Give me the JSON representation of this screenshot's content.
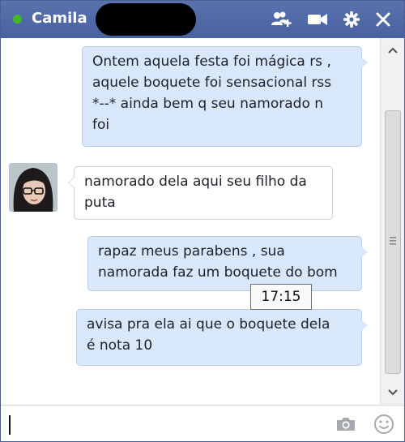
{
  "header": {
    "contact_name": "Camila",
    "status": "online",
    "icons": [
      "add-friends-icon",
      "video-camera-icon",
      "gear-icon",
      "close-icon"
    ]
  },
  "messages": [
    {
      "direction": "out",
      "lines": [
        "Ontem aquela festa foi mágica rs ,",
        "aquele boquete foi sensacional rss",
        "*--* ainda bem q seu namorado n",
        "foi"
      ]
    },
    {
      "direction": "in",
      "lines": [
        "namorado dela aqui seu filho da",
        "puta"
      ]
    },
    {
      "direction": "out",
      "lines": [
        "rapaz meus parabens , sua",
        "namorada faz um boquete do bom"
      ]
    },
    {
      "direction": "out",
      "lines": [
        "avisa pra ela ai que o boquete dela",
        "é nota 10"
      ]
    }
  ],
  "tooltip": {
    "time": "17:15"
  },
  "compose": {
    "value": "",
    "icons": [
      "camera-icon",
      "emoji-icon"
    ]
  },
  "colors": {
    "titlebar": "#4c66a4",
    "outgoing_bubble": "#d9e7fb",
    "incoming_bubble": "#ffffff",
    "online": "#42b72a"
  }
}
